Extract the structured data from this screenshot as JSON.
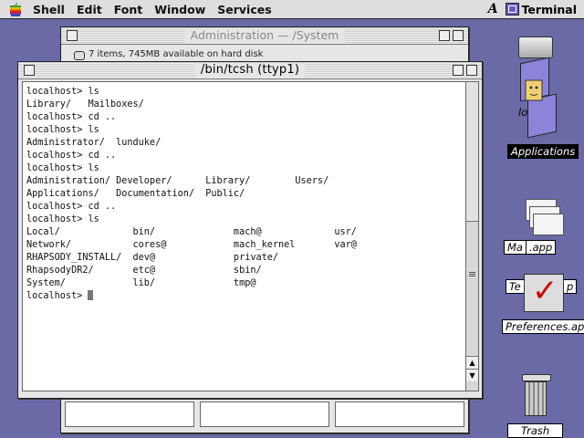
{
  "menubar": {
    "items": [
      "Shell",
      "Edit",
      "Font",
      "Window",
      "Services"
    ],
    "right_glyph": "A",
    "active_app": "Terminal"
  },
  "admin_window": {
    "title": "Administration — /System",
    "status": "7 items, 745MB available on hard disk"
  },
  "terminal": {
    "title": "/bin/tcsh (ttyp1)",
    "lines": [
      "localhost> ls",
      "Library/   Mailboxes/",
      "localhost> cd ..",
      "localhost> ls",
      "Administrator/  lunduke/",
      "localhost> cd ..",
      "localhost> ls",
      "Administration/ Developer/      Library/        Users/",
      "Applications/   Documentation/  Public/",
      "localhost> cd ..",
      "localhost> ls",
      "Local/             bin/              mach@             usr/",
      "Network/           cores@            mach_kernel       var@",
      "RHAPSODY_INSTALL/  dev@              private/",
      "RhapsodyDR2/       etc@              sbin/",
      "System/            lib/              tmp@"
    ],
    "prompt": "localhost> "
  },
  "desktop": {
    "icons": [
      {
        "label": "Applications",
        "icon": "folder-icon",
        "selected": true
      },
      {
        "label": "Ma",
        "suffix": ".app",
        "icon": "mail-icon"
      },
      {
        "label": "Te",
        "suffix": "p",
        "icon": "textedit-icon"
      },
      {
        "label": "Preferences.app",
        "icon": "preferences-icon"
      },
      {
        "label": "Trash",
        "icon": "trash-icon"
      }
    ],
    "partial_label": "lo"
  },
  "colors": {
    "desktop": "#6a6aa6",
    "window_frame": "#e6e6e6",
    "selection": "#000000"
  }
}
